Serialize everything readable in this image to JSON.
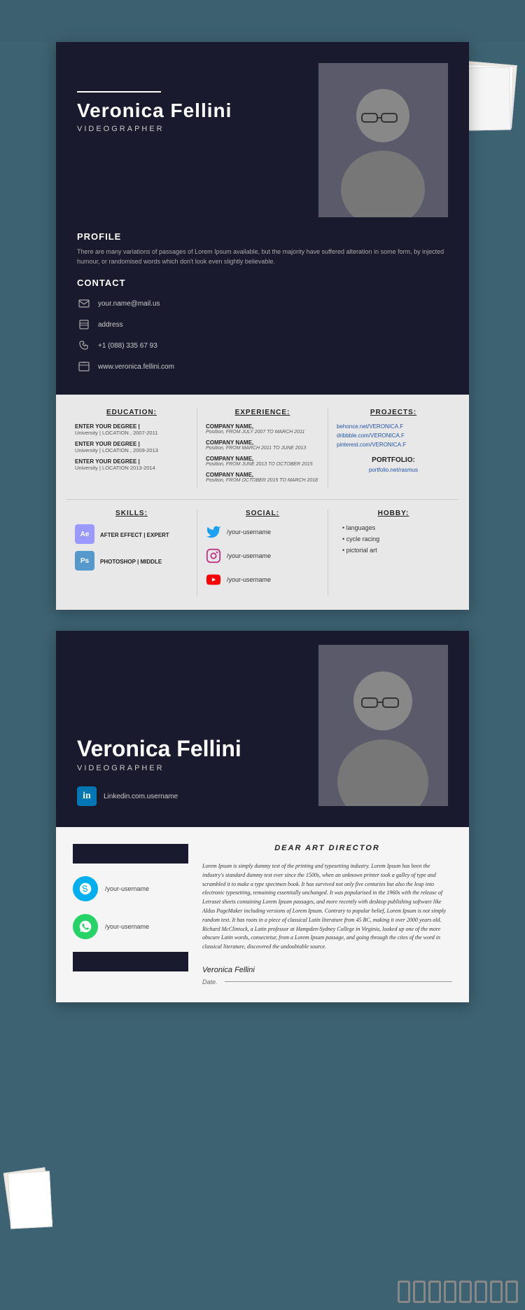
{
  "page": {
    "bg_color": "#3d6272"
  },
  "resume1": {
    "name": "Veronica Fellini",
    "title": "VIDEOGRAPHER",
    "profile": {
      "label": "PROFILE",
      "text": "There are many variations of passages of Lorem Ipsum available, but the majority have suffered alteration in some form, by injected humour, or randomised words which don't look even slightly believable."
    },
    "contact": {
      "label": "CONTACT",
      "items": [
        {
          "icon": "email-icon",
          "text": "your.name@mail.us"
        },
        {
          "icon": "home-icon",
          "text": "address"
        },
        {
          "icon": "phone-icon",
          "text": "+1 (088) 335 67 93"
        },
        {
          "icon": "web-icon",
          "text": "www.veronica.fellini.com"
        }
      ]
    },
    "education": {
      "label": "EDUCATION:",
      "items": [
        {
          "degree": "ENTER YOUR DEGREE |",
          "sub": "University | LOCATION , 2007-2011"
        },
        {
          "degree": "ENTER YOUR DEGREE |",
          "sub": "University | LOCATION , 2009-2013"
        },
        {
          "degree": "ENTER YOUR DEGREE |",
          "sub": "University | LOCATION 2013-2014"
        }
      ]
    },
    "experience": {
      "label": "EXPERIENCE:",
      "items": [
        {
          "company": "COMPANY NAME,",
          "detail": "Position, FROM JULY 2007 TO MARCH 2011"
        },
        {
          "company": "COMPANY NAME,",
          "detail": "Position, FROM MARCH 2011 TO JUNE 2013"
        },
        {
          "company": "COMPANY NAME,",
          "detail": "Position, FROM JUNE 2013 TO OCTOBER 2015"
        },
        {
          "company": "COMPANY NAME,",
          "detail": "Position, FROM OCTOBER 2015 TO MARCH 2018"
        }
      ]
    },
    "projects": {
      "label": "PROJECTS:",
      "links": [
        "behonce.net/VERONICA.F",
        "dribbble.com/VERONICA.F",
        "pinterest.com/VERONICA.F"
      ],
      "portfolio_label": "PORTFOLIO:",
      "portfolio_link": "portfolio.net/rasmus"
    },
    "skills": {
      "label": "SKILLS:",
      "items": [
        {
          "name": "AFTER EFFECT",
          "level": "EXPERT",
          "icon": "Ae",
          "color": "#9999ff"
        },
        {
          "name": "PHOTOSHOP",
          "level": "MIDDLE",
          "icon": "Ps",
          "color": "#5599cc"
        }
      ]
    },
    "social": {
      "label": "SOCIAL:",
      "items": [
        {
          "platform": "twitter",
          "handle": "/your-username"
        },
        {
          "platform": "instagram",
          "handle": "/your-username"
        },
        {
          "platform": "youtube",
          "handle": "/your-username"
        }
      ]
    },
    "hobby": {
      "label": "HOBBY:",
      "items": [
        "languages",
        "cycle racing",
        "pictorial art"
      ]
    }
  },
  "resume2": {
    "name": "Veronica Fellini",
    "title": "VIDEOGRAPHER",
    "linkedin": "Linkedin.com.username",
    "cover": {
      "dear_title": "DEAR ART DIRECTOR",
      "body": "Lorem Ipsum is simply dummy text of the printing and typesetting industry. Lorem Ipsum has been the industry's standard dummy text ever since the 1500s, when an unknown printer took a galley of type and scrambled it to make a type specimen book. It has survived not only five centuries but also the leap into electronic typesetting, remaining essentially unchanged. It was popularised in the 1960s with the release of Letraset sheets containing Lorem Ipsum passages, and more recently with desktop publishing software like Aldus PageMaker including versions of Lorem Ipsum. Contrary to popular belief, Lorem Ipsum is not simply random text. It has roots in a piece of classical Latin literature from 45 BC, making it over 2000 years old. Richard McClintock, a Latin professor at Hampden-Sydney College in Virginia, looked up one of the more obscure Latin words, consectetur, from a Lorem Ipsum passage, and going through the cites of the word in classical literature, discovered the undoubtable source.",
      "signature": "Veronica Fellini",
      "date_label": "Date."
    },
    "social": [
      {
        "platform": "skype",
        "handle": "/your-username"
      },
      {
        "platform": "whatsapp",
        "handle": "/your-username"
      }
    ]
  }
}
